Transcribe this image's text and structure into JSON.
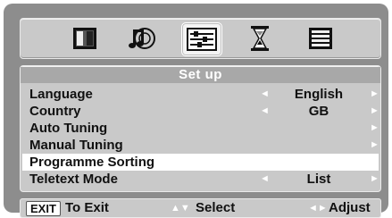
{
  "tabs": [
    {
      "name": "picture-icon"
    },
    {
      "name": "sound-icon"
    },
    {
      "name": "setup-icon",
      "selected": true
    },
    {
      "name": "timer-icon"
    },
    {
      "name": "teletext-icon"
    }
  ],
  "menu": {
    "title": "Set up",
    "items": [
      {
        "label": "Language",
        "value": "English",
        "left_arrow": "◄",
        "right_arrow": "►"
      },
      {
        "label": "Country",
        "value": "GB",
        "left_arrow": "◄",
        "right_arrow": "►"
      },
      {
        "label": "Auto Tuning",
        "value": "",
        "left_arrow": "",
        "right_arrow": "►"
      },
      {
        "label": "Manual Tuning",
        "value": "",
        "left_arrow": "",
        "right_arrow": "►"
      },
      {
        "label": "Programme Sorting",
        "value": "",
        "left_arrow": "",
        "right_arrow": "►",
        "highlighted": true
      },
      {
        "label": "Teletext Mode",
        "value": "List",
        "left_arrow": "◄",
        "right_arrow": "►"
      }
    ]
  },
  "footer": {
    "exit_key": "EXIT",
    "exit_label": "To Exit",
    "select_arrows": "▲▼",
    "select_label": "Select",
    "adjust_arrows": "◄►",
    "adjust_label": "Adjust"
  },
  "colors": {
    "frame": "#8d8d8d",
    "panel": "#c9c9c9",
    "title_bar": "#a8a8a8",
    "highlight": "#ffffff",
    "arrow": "#ffffff"
  }
}
